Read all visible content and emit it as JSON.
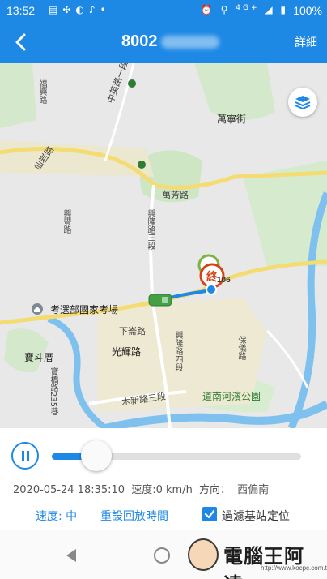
{
  "status_bar": {
    "time": "13:52",
    "network": "4G+",
    "battery": "100%"
  },
  "app_bar": {
    "title": "8002",
    "detail_label": "詳細"
  },
  "map": {
    "labels": {
      "fuxin": "福興路",
      "zhongxing": "中英路一段",
      "wanning": "萬寧街",
      "xianshan": "仙岩路",
      "xingfeng": "興豐路",
      "wanfang": "萬芳路",
      "xinglong3": "興隆路三段",
      "exam_center": "考選部國家考場",
      "road106": "106",
      "xiahai": "下崙路",
      "baodou": "寶斗厝",
      "guangming": "光輝路",
      "xinglong4": "興隆路四段",
      "baoyi": "保儀路",
      "muxin3": "木新路三段",
      "daonan": "道南河濱公園",
      "baoqiao": "寶橋路235巷",
      "end_marker": "終"
    },
    "colors": {
      "route": "#1e88e5",
      "end_marker": "#d84315",
      "start_marker": "#7cb342",
      "vehicle": "#43a047",
      "river": "#64b5f6",
      "park": "#cde8c2",
      "road_major": "#f6e07a"
    }
  },
  "playback": {
    "progress": 0.18,
    "info": {
      "timestamp": "2020-05-24 18:35:10",
      "speed": "速度:0 km/h",
      "direction": "方向：",
      "direction_value": "西偏南"
    },
    "speed_label": "速度: 中",
    "reset_label": "重設回放時間",
    "filter_label": "過濾基站定位",
    "filter_checked": true
  },
  "watermark": {
    "text": "電腦王阿達",
    "url": "http://www.kocpc.com.tw"
  }
}
